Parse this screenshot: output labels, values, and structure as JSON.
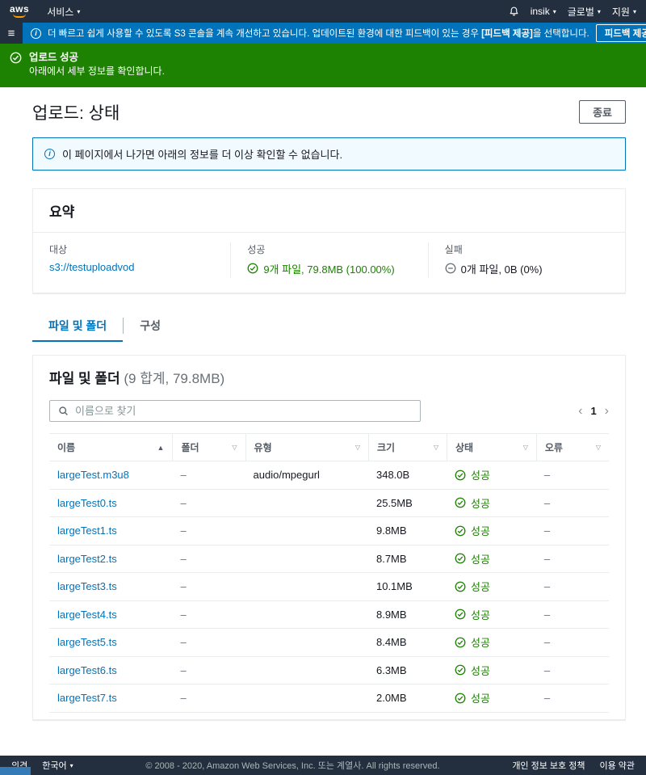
{
  "colors": {
    "navy": "#232f3e",
    "info_blue": "#0073bb",
    "success_green": "#1d8102",
    "link_blue": "#0073bb",
    "aws_orange": "#ff9900"
  },
  "icons": {
    "hamburger": "≡",
    "caret_down": "▾",
    "sort_asc": "▲",
    "filter": "▽",
    "close": "✕",
    "chevron_left": "‹",
    "chevron_right": "›"
  },
  "topnav": {
    "logo": "aws",
    "services": "서비스",
    "account": "insik",
    "region": "글로벌",
    "support": "지원"
  },
  "info_banner": {
    "msg_pre": "더 빠르고 쉽게 사용할 수 있도록 S3 콘솔을 계속 개선하고 있습니다. 업데이트된 환경에 대한 피드백이 있는 경우 ",
    "msg_bold": "[피드백 제공]",
    "msg_post": "을 선택합니다.",
    "button": "피드백 제공"
  },
  "success_banner": {
    "title": "업로드 성공",
    "subtitle": "아래에서 세부 정보를 확인합니다."
  },
  "page": {
    "title": "업로드: 상태",
    "close_button": "종료",
    "notice": "이 페이지에서 나가면 아래의 정보를 더 이상 확인할 수 없습니다."
  },
  "summary": {
    "title": "요약",
    "target_label": "대상",
    "target_value": "s3://testuploadvod",
    "success_label": "성공",
    "success_value": "9개 파일, 79.8MB (100.00%)",
    "failed_label": "실패",
    "failed_value": "0개 파일, 0B (0%)"
  },
  "tabs": [
    {
      "label": "파일 및 폴더",
      "active": true
    },
    {
      "label": "구성",
      "active": false
    }
  ],
  "files": {
    "title": "파일 및 폴더",
    "count": "(9 합계, 79.8MB)",
    "search_placeholder": "이름으로 찾기",
    "pagination": {
      "prev": "‹",
      "page": "1",
      "next": "›"
    },
    "columns": [
      "이름",
      "폴더",
      "유형",
      "크기",
      "상태",
      "오류"
    ],
    "rows": [
      {
        "name": "largeTest.m3u8",
        "folder": "–",
        "type": "audio/mpegurl",
        "size": "348.0B",
        "status": "성공",
        "error": "–"
      },
      {
        "name": "largeTest0.ts",
        "folder": "–",
        "type": "",
        "size": "25.5MB",
        "status": "성공",
        "error": "–"
      },
      {
        "name": "largeTest1.ts",
        "folder": "–",
        "type": "",
        "size": "9.8MB",
        "status": "성공",
        "error": "–"
      },
      {
        "name": "largeTest2.ts",
        "folder": "–",
        "type": "",
        "size": "8.7MB",
        "status": "성공",
        "error": "–"
      },
      {
        "name": "largeTest3.ts",
        "folder": "–",
        "type": "",
        "size": "10.1MB",
        "status": "성공",
        "error": "–"
      },
      {
        "name": "largeTest4.ts",
        "folder": "–",
        "type": "",
        "size": "8.9MB",
        "status": "성공",
        "error": "–"
      },
      {
        "name": "largeTest5.ts",
        "folder": "–",
        "type": "",
        "size": "8.4MB",
        "status": "성공",
        "error": "–"
      },
      {
        "name": "largeTest6.ts",
        "folder": "–",
        "type": "",
        "size": "6.3MB",
        "status": "성공",
        "error": "–"
      },
      {
        "name": "largeTest7.ts",
        "folder": "–",
        "type": "",
        "size": "2.0MB",
        "status": "성공",
        "error": "–"
      }
    ]
  },
  "footer": {
    "feedback": "의견",
    "language": "한국어",
    "copyright": "© 2008 - 2020, Amazon Web Services, Inc. 또는 계열사. All rights reserved.",
    "privacy": "개인 정보 보호 정책",
    "terms": "이용 약관"
  }
}
